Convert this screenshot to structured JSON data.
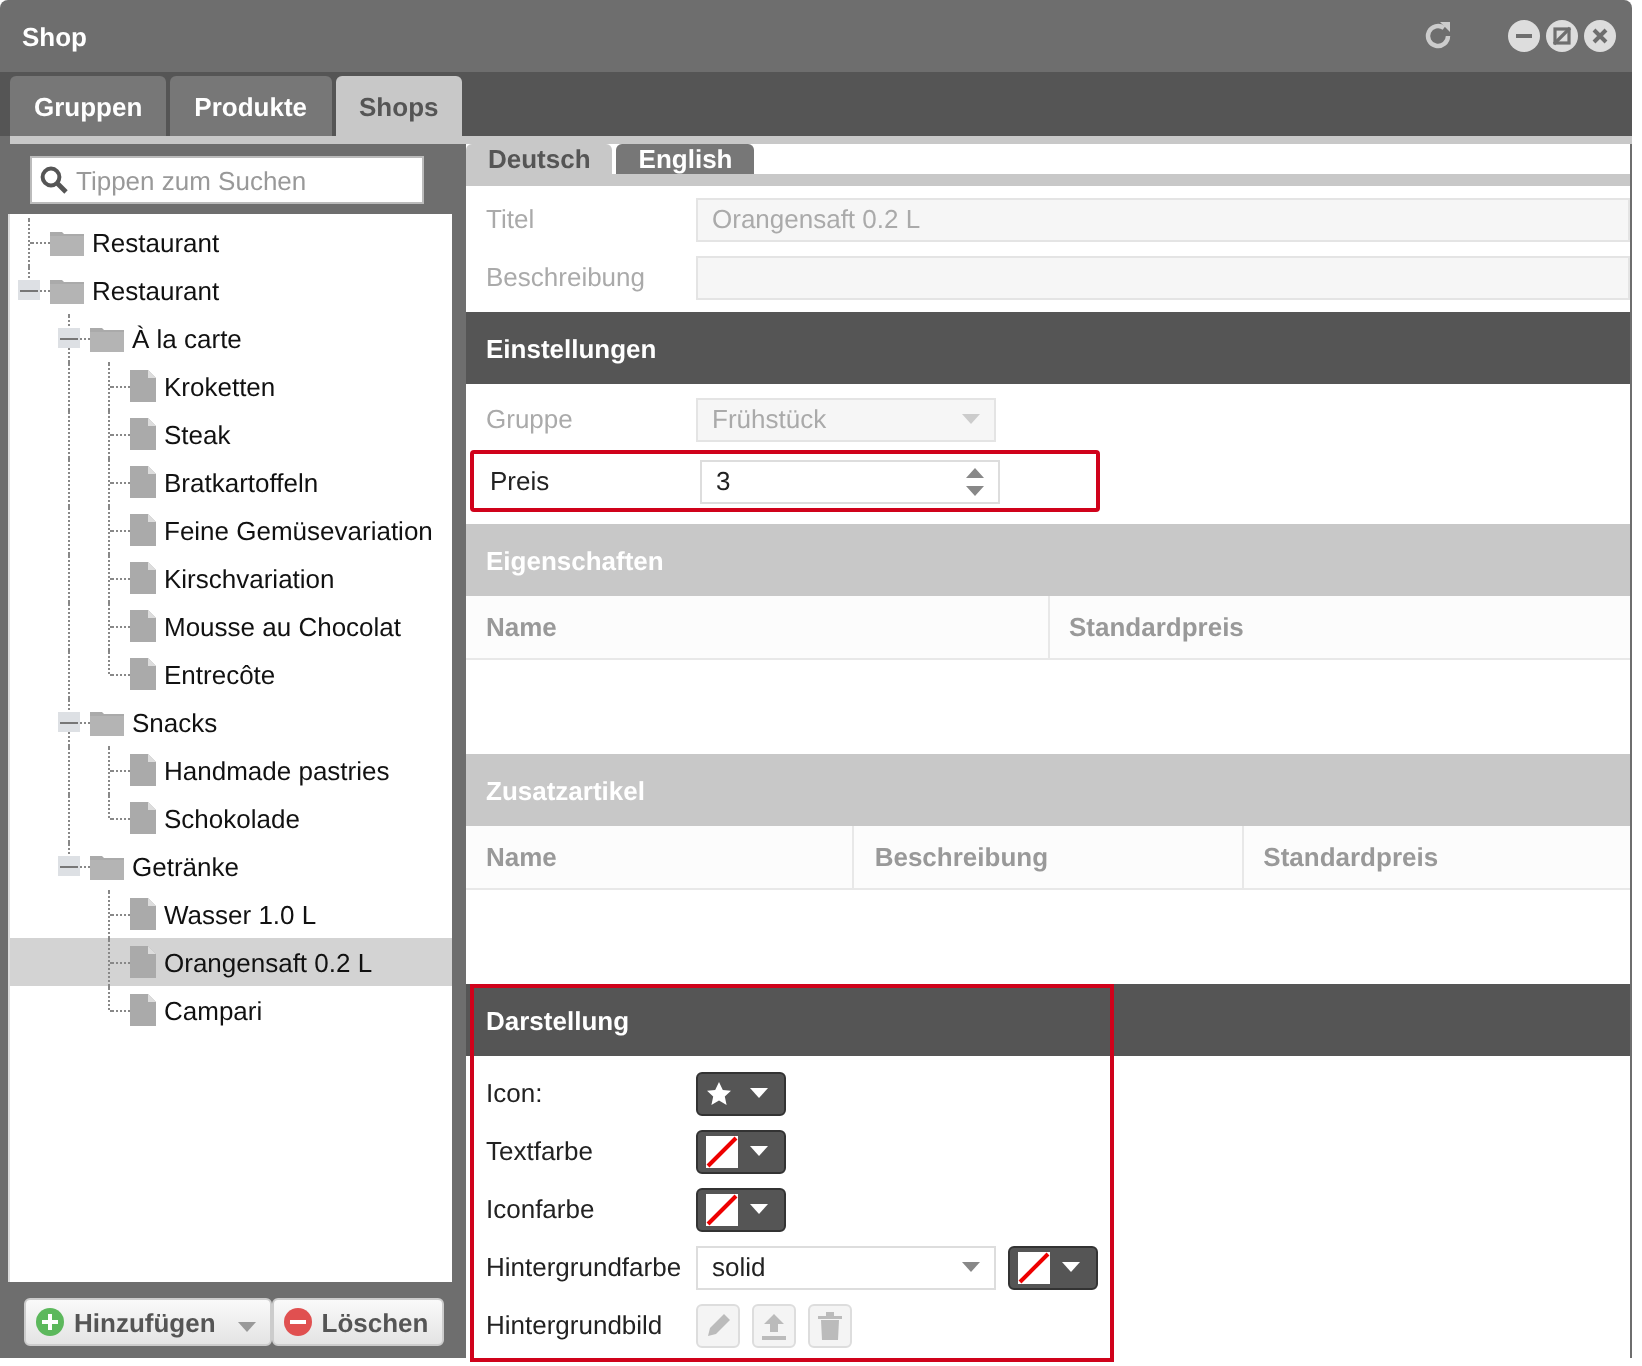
{
  "window": {
    "title": "Shop"
  },
  "tabs": [
    {
      "label": "Gruppen",
      "selected": false
    },
    {
      "label": "Produkte",
      "selected": false
    },
    {
      "label": "Shops",
      "selected": true
    }
  ],
  "search": {
    "placeholder": "Tippen zum Suchen"
  },
  "tree": [
    {
      "label": "Restaurant",
      "kind": "folder",
      "selected": false
    },
    {
      "label": "Restaurant",
      "kind": "folder",
      "selected": false,
      "expanded": true,
      "children": [
        {
          "label": "À la carte",
          "kind": "folder",
          "selected": false,
          "expanded": true,
          "children": [
            {
              "label": "Kroketten",
              "kind": "item",
              "selected": false
            },
            {
              "label": "Steak",
              "kind": "item",
              "selected": false
            },
            {
              "label": "Bratkartoffeln",
              "kind": "item",
              "selected": false
            },
            {
              "label": "Feine Gemüsevariation",
              "kind": "item",
              "selected": false
            },
            {
              "label": "Kirschvariation",
              "kind": "item",
              "selected": false
            },
            {
              "label": "Mousse au Chocolat",
              "kind": "item",
              "selected": false
            },
            {
              "label": "Entrecôte",
              "kind": "item",
              "selected": false
            }
          ]
        },
        {
          "label": "Snacks",
          "kind": "folder",
          "selected": false,
          "expanded": true,
          "children": [
            {
              "label": "Handmade pastries",
              "kind": "item",
              "selected": false
            },
            {
              "label": "Schokolade",
              "kind": "item",
              "selected": false
            }
          ]
        },
        {
          "label": "Getränke",
          "kind": "folder",
          "selected": false,
          "expanded": true,
          "children": [
            {
              "label": "Wasser 1.0 L",
              "kind": "item",
              "selected": false
            },
            {
              "label": "Orangensaft 0.2 L",
              "kind": "item",
              "selected": true
            },
            {
              "label": "Campari",
              "kind": "item",
              "selected": false
            }
          ]
        }
      ]
    }
  ],
  "tree_buttons": [
    {
      "label": "Hinzufügen",
      "kind": "add"
    },
    {
      "label": "Löschen",
      "kind": "delete"
    }
  ],
  "language_tabs": [
    {
      "label": "Deutsch",
      "selected": true
    },
    {
      "label": "English",
      "selected": false
    }
  ],
  "general_fields": [
    {
      "label": "Titel",
      "value": "Orangensaft 0.2 L",
      "disabled": true
    },
    {
      "label": "Beschreibung",
      "disabled": true
    }
  ],
  "sections": [
    {
      "title": "Einstellungen",
      "enabled": true,
      "kind": "form",
      "highlighted": false,
      "fields": [
        {
          "label": "Gruppe",
          "kind": "select",
          "value": "Frühstück",
          "disabled": true,
          "highlighted": false
        },
        {
          "label": "Preis",
          "kind": "spinner",
          "value": "3",
          "disabled": false,
          "highlighted": true
        }
      ]
    },
    {
      "title": "Eigenschaften",
      "enabled": false,
      "kind": "table",
      "highlighted": false,
      "columns": [
        "Name",
        "Standardpreis"
      ]
    },
    {
      "title": "Zusatzartikel",
      "enabled": false,
      "kind": "table",
      "highlighted": false,
      "columns": [
        "Name",
        "Beschreibung",
        "Standardpreis"
      ]
    },
    {
      "title": "Darstellung",
      "enabled": true,
      "kind": "appearance",
      "highlighted": true,
      "rows": [
        {
          "label": "Icon:",
          "kind": "icon_picker"
        },
        {
          "label": "Textfarbe",
          "kind": "color_picker"
        },
        {
          "label": "Iconfarbe",
          "kind": "color_picker"
        },
        {
          "label": "Hintergrundfarbe",
          "kind": "select_color",
          "value": "solid"
        },
        {
          "label": "Hintergrundbild",
          "kind": "image_buttons",
          "disabled": true
        }
      ]
    }
  ]
}
